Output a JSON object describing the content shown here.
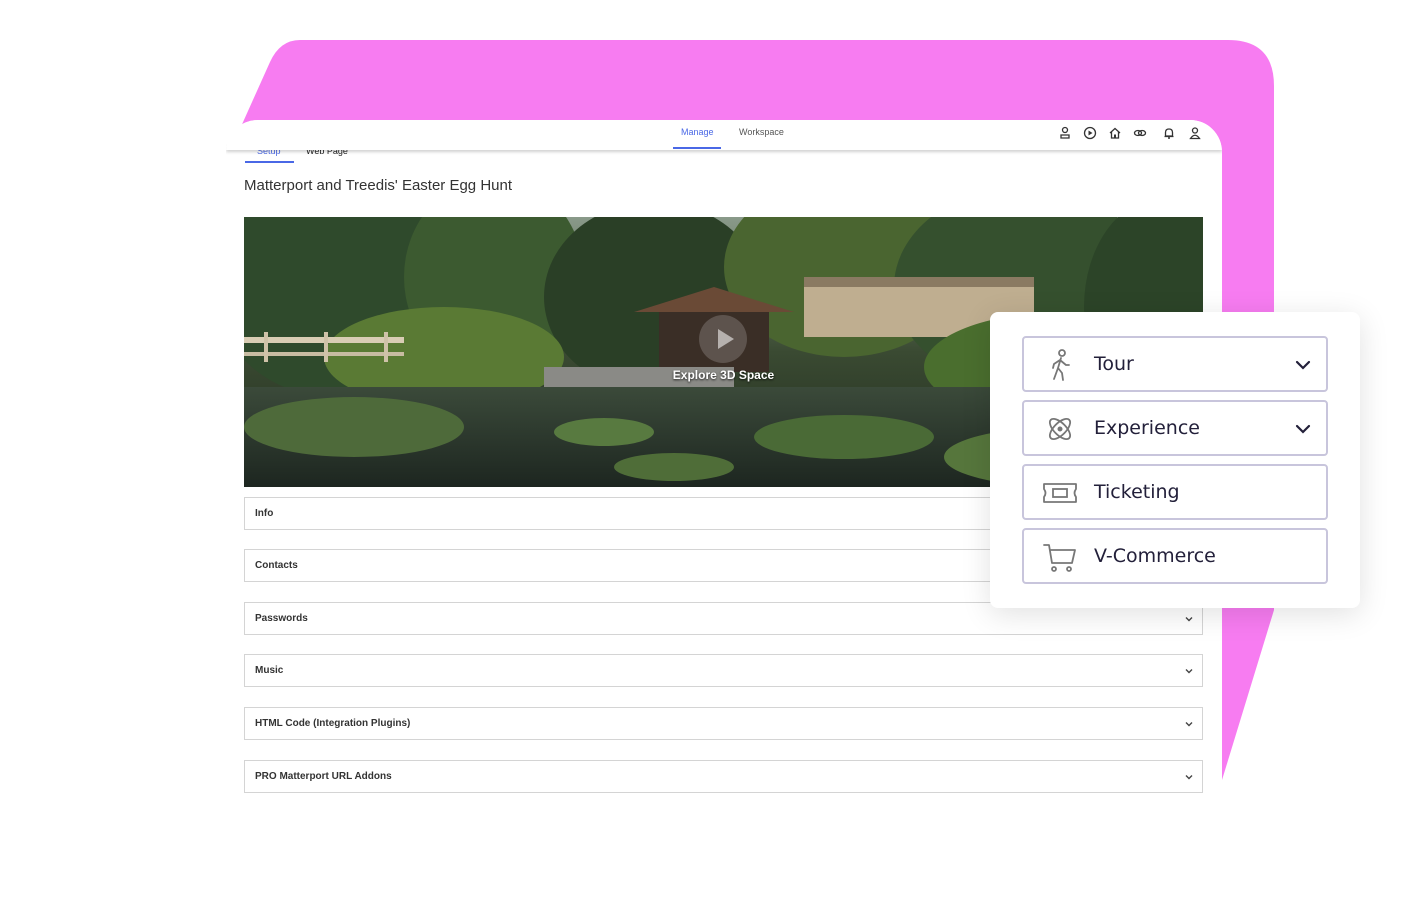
{
  "topbar": {
    "tabs": [
      {
        "label": "Manage",
        "active": true
      },
      {
        "label": "Workspace",
        "active": false
      }
    ],
    "icons": [
      "account-stamp-icon",
      "play-circle-icon",
      "home-icon",
      "link-icon",
      "bell-icon",
      "user-icon"
    ]
  },
  "subtabs": [
    {
      "label": "Setup",
      "active": true
    },
    {
      "label": "Web Page",
      "active": false
    }
  ],
  "page": {
    "title": "Matterport and Treedis' Easter Egg Hunt",
    "hero_label": "Explore 3D Space"
  },
  "sections": [
    {
      "label": "Info"
    },
    {
      "label": "Contacts"
    },
    {
      "label": "Passwords"
    },
    {
      "label": "Music"
    },
    {
      "label": "HTML Code (Integration Plugins)"
    },
    {
      "label": "PRO Matterport URL Addons"
    }
  ],
  "menu": {
    "items": [
      {
        "label": "Tour",
        "icon": "walking-person-icon",
        "expandable": true
      },
      {
        "label": "Experience",
        "icon": "atom-icon",
        "expandable": true
      },
      {
        "label": "Ticketing",
        "icon": "ticket-icon",
        "expandable": false
      },
      {
        "label": "V-Commerce",
        "icon": "cart-icon",
        "expandable": false
      }
    ]
  },
  "colors": {
    "accent": "#4a68e6",
    "backdrop": "#f77cf1",
    "menu_border": "#c8c5dc"
  }
}
